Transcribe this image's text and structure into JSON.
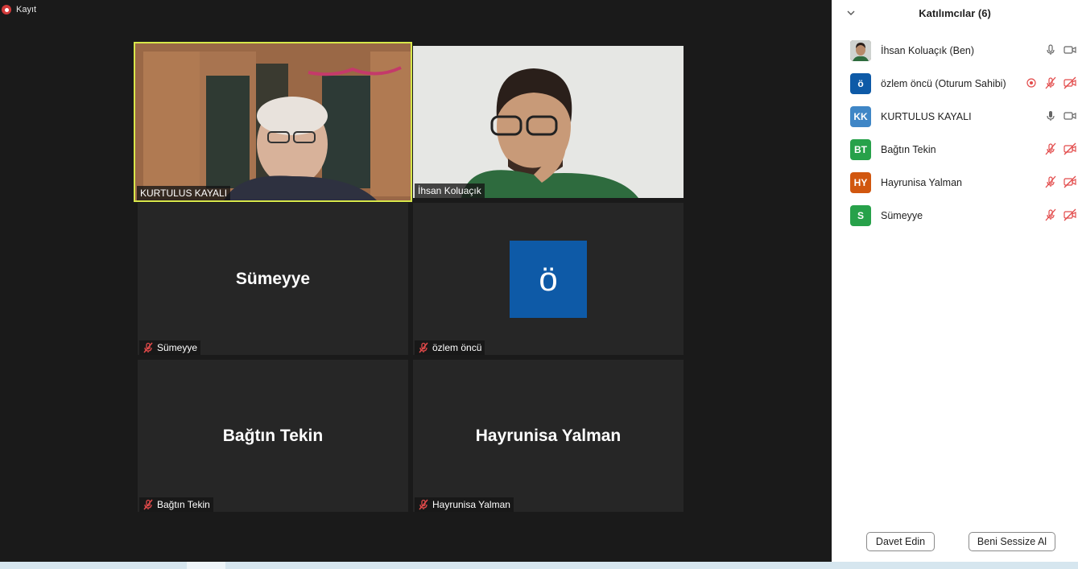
{
  "recording": {
    "label": "Kayıt"
  },
  "tiles": [
    {
      "name": "KURTULUS KAYALI",
      "muted": false
    },
    {
      "name": "İhsan Koluaçık",
      "muted": false
    },
    {
      "name": "Sümeyye",
      "center": "Sümeyye",
      "muted": true
    },
    {
      "name": "özlem öncü",
      "center": "ö",
      "muted": true
    },
    {
      "name": "Bağtın Tekin",
      "center": "Bağtın Tekin",
      "muted": true
    },
    {
      "name": "Hayrunisa Yalman",
      "center": "Hayrunisa Yalman",
      "muted": true
    }
  ],
  "panel": {
    "title": "Katılımcılar (6)",
    "participants": [
      {
        "initials": "",
        "name": "İhsan Koluaçık (Ben)",
        "color": "#4a4a4a",
        "mic": "on",
        "video": "on"
      },
      {
        "initials": "ö",
        "name": "özlem öncü (Oturum Sahibi)",
        "color": "#0e5aa7",
        "mic": "off",
        "video": "off",
        "recording": true
      },
      {
        "initials": "KK",
        "name": "KURTULUS KAYALI",
        "color": "#3f86c6",
        "mic": "on",
        "video": "on"
      },
      {
        "initials": "BT",
        "name": "Bağtın Tekin",
        "color": "#27a14a",
        "mic": "off",
        "video": "off"
      },
      {
        "initials": "HY",
        "name": "Hayrunisa Yalman",
        "color": "#d1570f",
        "mic": "off",
        "video": "off"
      },
      {
        "initials": "S",
        "name": "Sümeyye",
        "color": "#27a14a",
        "mic": "off",
        "video": "off"
      }
    ],
    "invite_label": "Davet Edin",
    "mute_me_label": "Beni Sessize Al"
  }
}
